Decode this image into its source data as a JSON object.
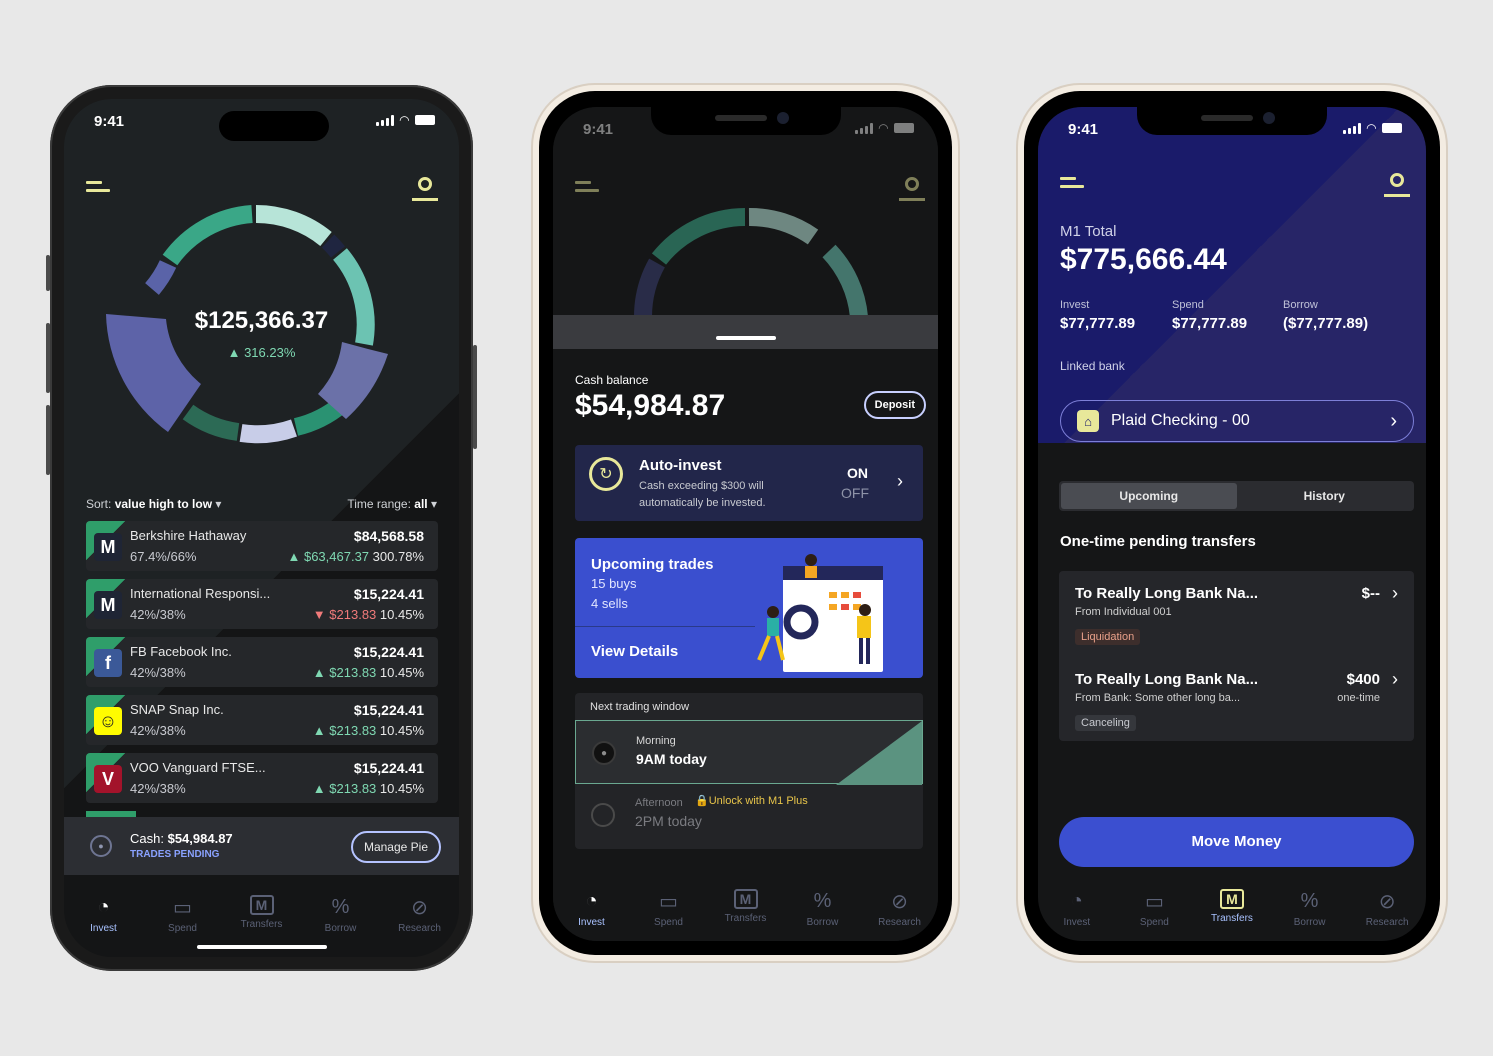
{
  "status": {
    "time": "9:41"
  },
  "phone1": {
    "portfolio_value": "$125,366.37",
    "portfolio_change": "316.23%",
    "sort_label": "Sort:",
    "sort_value": "value high to low",
    "time_range_label": "Time range:",
    "time_range_value": "all",
    "holdings": [
      {
        "name": "Berkshire Hathaway",
        "alloc": "67.4%/66%",
        "value": "$84,568.58",
        "gain": "$63,467.37",
        "gain_pct": "300.78%",
        "direction": "up",
        "logo": "M",
        "logo_color": "#1f2535"
      },
      {
        "name": "International Responsi...",
        "alloc": "42%/38%",
        "value": "$15,224.41",
        "gain": "$213.83",
        "gain_pct": "10.45%",
        "direction": "down",
        "logo": "M",
        "logo_color": "#1f2535"
      },
      {
        "name": "FB Facebook Inc.",
        "alloc": "42%/38%",
        "value": "$15,224.41",
        "gain": "$213.83",
        "gain_pct": "10.45%",
        "direction": "up",
        "logo": "f",
        "logo_color": "#3b5998"
      },
      {
        "name": "SNAP Snap Inc.",
        "alloc": "42%/38%",
        "value": "$15,224.41",
        "gain": "$213.83",
        "gain_pct": "10.45%",
        "direction": "up",
        "logo": "☺",
        "logo_color": "#fffc00"
      },
      {
        "name": "VOO Vanguard FTSE...",
        "alloc": "42%/38%",
        "value": "$15,224.41",
        "gain": "$213.83",
        "gain_pct": "10.45%",
        "direction": "up",
        "logo": "V",
        "logo_color": "#a3132b"
      }
    ],
    "cash_label": "Cash:",
    "cash_value": "$54,984.87",
    "trades_pending": "TRADES PENDING",
    "manage_pie": "Manage Pie"
  },
  "phone2": {
    "cash_balance_label": "Cash balance",
    "cash_balance": "$54,984.87",
    "deposit": "Deposit",
    "auto_invest_title": "Auto-invest",
    "auto_invest_desc": "Cash exceeding $300 will automatically be invested.",
    "toggle_on": "ON",
    "toggle_off": "OFF",
    "upcoming_title": "Upcoming trades",
    "buys": "15 buys",
    "sells": "4 sells",
    "view_details": "View Details",
    "next_window_label": "Next trading window",
    "morning_label": "Morning",
    "morning_time": "9AM today",
    "afternoon_label": "Afternoon",
    "unlock_label": "Unlock with M1 Plus",
    "afternoon_time": "2PM today"
  },
  "phone3": {
    "total_label": "M1 Total",
    "total_value": "$775,666.44",
    "invest_label": "Invest",
    "invest_value": "$77,777.89",
    "spend_label": "Spend",
    "spend_value": "$77,777.89",
    "borrow_label": "Borrow",
    "borrow_value": "($77,777.89)",
    "linked_bank_label": "Linked bank",
    "linked_bank": "Plaid Checking - 00",
    "tab_upcoming": "Upcoming",
    "tab_history": "History",
    "section_title": "One-time pending transfers",
    "transfers": [
      {
        "title": "To Really Long Bank Na...",
        "from": "From Individual 001",
        "amount": "$--",
        "freq": "",
        "tag": "Liquidation",
        "tag_color": "#e8a08a",
        "tag_bg": "#3d2e2c"
      },
      {
        "title": "To Really Long Bank Na...",
        "from": "From Bank: Some other long ba...",
        "amount": "$400",
        "freq": "one-time",
        "tag": "Canceling",
        "tag_color": "#c8cad0",
        "tag_bg": "#35373c"
      }
    ],
    "move_money": "Move Money"
  },
  "tabs": [
    "Invest",
    "Spend",
    "Transfers",
    "Borrow",
    "Research"
  ],
  "colors": {
    "accent_yellow": "#e8e89a",
    "brand_blue": "#3b4fd0",
    "positive": "#7fd8b2",
    "negative": "#f07a7a"
  }
}
